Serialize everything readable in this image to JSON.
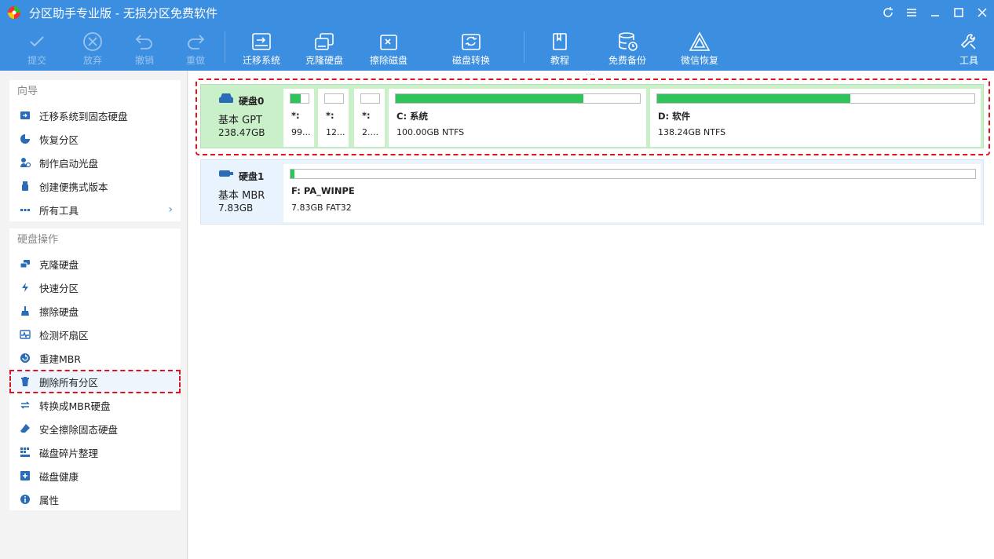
{
  "window": {
    "title": "分区助手专业版 - 无损分区免费软件"
  },
  "toolbar": {
    "commit": "提交",
    "discard": "放弃",
    "undo": "撤销",
    "redo": "重做",
    "migrate": "迁移系统",
    "clone": "克隆硬盘",
    "wipe": "擦除磁盘",
    "convert": "磁盘转换",
    "tutorial": "教程",
    "backup": "免费备份",
    "wechat": "微信恢复",
    "tools": "工具"
  },
  "wizard": {
    "title": "向导",
    "items": [
      "迁移系统到固态硬盘",
      "恢复分区",
      "制作启动光盘",
      "创建便携式版本",
      "所有工具"
    ]
  },
  "diskops": {
    "title": "硬盘操作",
    "items": [
      "克隆硬盘",
      "快速分区",
      "擦除硬盘",
      "检测坏扇区",
      "重建MBR",
      "删除所有分区",
      "转换成MBR硬盘",
      "安全擦除固态硬盘",
      "磁盘碎片整理",
      "磁盘健康",
      "属性"
    ]
  },
  "disks": [
    {
      "name": "硬盘0",
      "type": "基本 GPT",
      "size": "238.47GB",
      "partitions": [
        {
          "name": "*:",
          "info": "99...",
          "used": 0.55
        },
        {
          "name": "*:",
          "info": "12...",
          "used": 0.0
        },
        {
          "name": "*:",
          "info": "2....",
          "used": 0.0
        },
        {
          "name": "C: 系统",
          "info": "100.00GB NTFS",
          "used": 0.77
        },
        {
          "name": "D: 软件",
          "info": "138.24GB NTFS",
          "used": 0.61
        }
      ]
    },
    {
      "name": "硬盘1",
      "type": "基本 MBR",
      "size": "7.83GB",
      "partitions": [
        {
          "name": "F: PA_WINPE",
          "info": "7.83GB FAT32",
          "used": 0.006
        }
      ]
    }
  ],
  "colors": {
    "accent": "#3c8fe0",
    "used": "#2ec45a",
    "highlight": "#e0121b"
  }
}
